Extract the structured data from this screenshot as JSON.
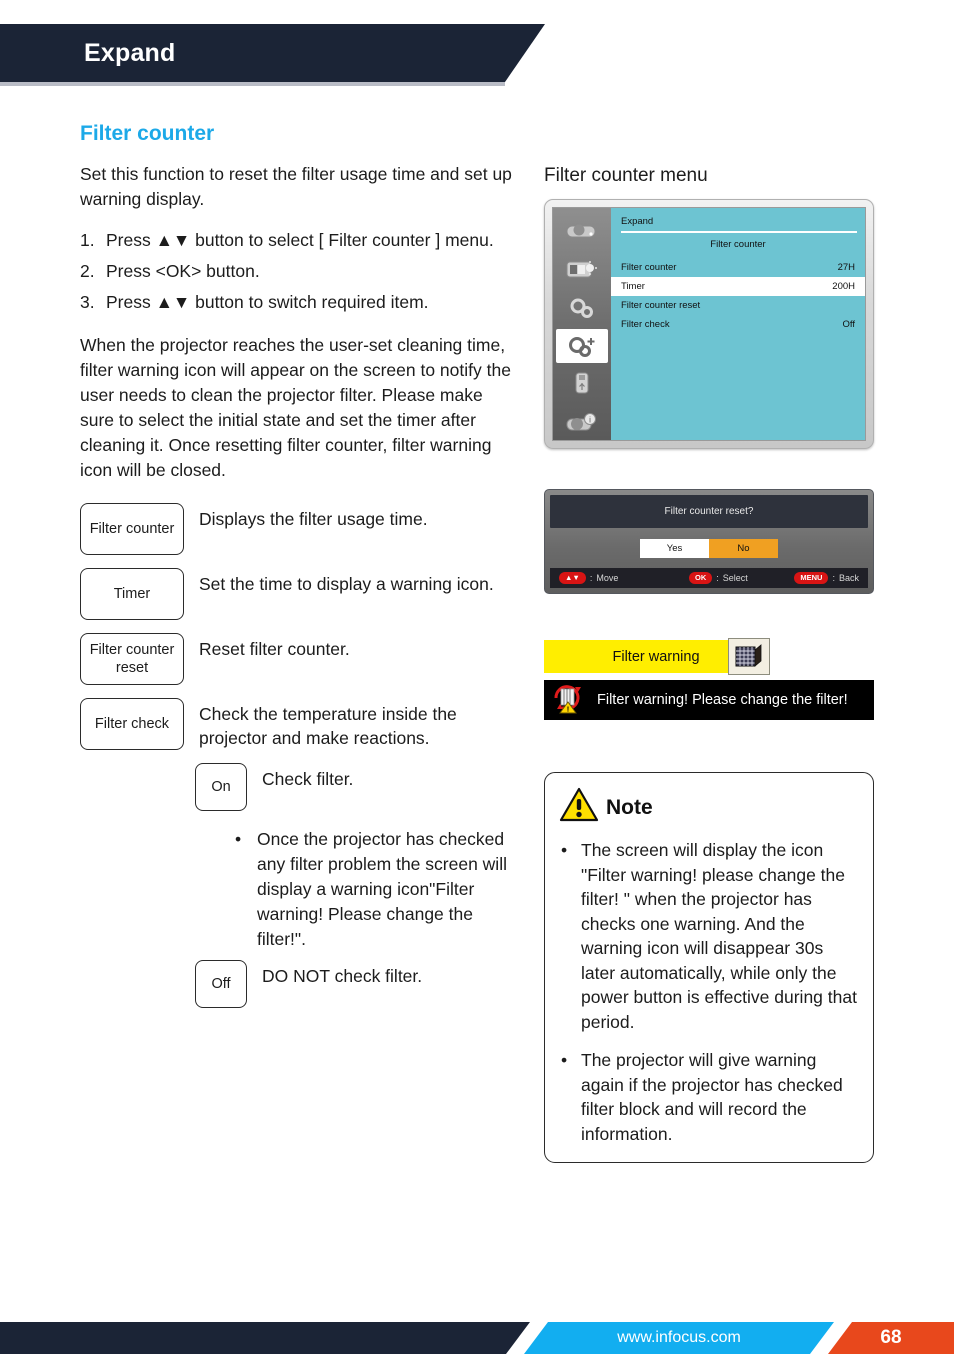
{
  "header": {
    "title": "Expand"
  },
  "left": {
    "section_title": "Filter counter",
    "intro": "Set this function to reset the filter usage time and set up warning display.",
    "steps": [
      {
        "num": "1.",
        "text": "Press ▲▼ button to select [ Filter counter ] menu."
      },
      {
        "num": "2.",
        "text": "Press <OK> button."
      },
      {
        "num": "3.",
        "text": "Press ▲▼ button to switch required item."
      }
    ],
    "body": "When the projector reaches the user-set cleaning time, filter warning icon will appear on the screen to notify the user needs to clean the projector filter. Please make sure to select the initial state and set the timer after cleaning it. Once resetting filter counter, filter warning icon will be closed.",
    "definitions": [
      {
        "key": "Filter counter",
        "desc": "Displays the filter usage time."
      },
      {
        "key": "Timer",
        "desc": "Set the time to display a warning icon."
      },
      {
        "key": "Filter counter reset",
        "desc": "Reset filter counter."
      },
      {
        "key": "Filter check",
        "desc": "Check the temperature inside the projector and make reactions."
      }
    ],
    "on_off": [
      {
        "key": "On",
        "desc": "Check filter."
      },
      {
        "key": "Off",
        "desc": "DO NOT check filter."
      }
    ],
    "on_bullet": "Once the projector has checked any filter problem the screen will display a warning icon\"Filter warning! Please change the filter!\"."
  },
  "right": {
    "menu_caption": "Filter counter menu",
    "osd": {
      "breadcrumb": "Expand",
      "subtitle": "Filter counter",
      "rows": [
        {
          "label": "Filter counter",
          "value": "27H",
          "highlighted": false
        },
        {
          "label": "Timer",
          "value": "200H",
          "highlighted": true
        },
        {
          "label": "Filter counter reset",
          "value": "",
          "highlighted": false
        },
        {
          "label": "Filter check",
          "value": "Off",
          "highlighted": false
        }
      ],
      "sidebar_icons": [
        "projector-icon",
        "image-adjust-icon",
        "settings-gear-icon",
        "expand-gear-icon",
        "usb-icon",
        "info-icon"
      ]
    },
    "dialog": {
      "message": "Filter counter reset?",
      "yes_label": "Yes",
      "no_label": "No",
      "hints": [
        {
          "badge": "▲▼",
          "sep": ":",
          "action": "Move"
        },
        {
          "badge": "OK",
          "sep": ":",
          "action": "Select"
        },
        {
          "badge": "MENU",
          "sep": ":",
          "action": "Back"
        }
      ]
    },
    "warning": {
      "label": "Filter warning",
      "banner": "Filter warning! Please change the filter!"
    },
    "note": {
      "title": "Note",
      "items": [
        "The screen will display the icon \"Filter warning! please change the filter! \" when the projector has checks one warning. And the warning icon will disappear 30s later automatically, while only the power button is effective during that period.",
        "The projector will give warning again if the projector has checked filter block and will record the information."
      ]
    }
  },
  "footer": {
    "url": "www.infocus.com",
    "page": "68"
  },
  "colors": {
    "header_navy": "#1b2436",
    "accent_blue": "#1ca9e8",
    "osd_teal": "#6dc4d2",
    "warn_yellow": "#ffee00",
    "no_orange": "#f0a022",
    "footer_blue": "#12aef0",
    "footer_orange": "#e8481c"
  }
}
